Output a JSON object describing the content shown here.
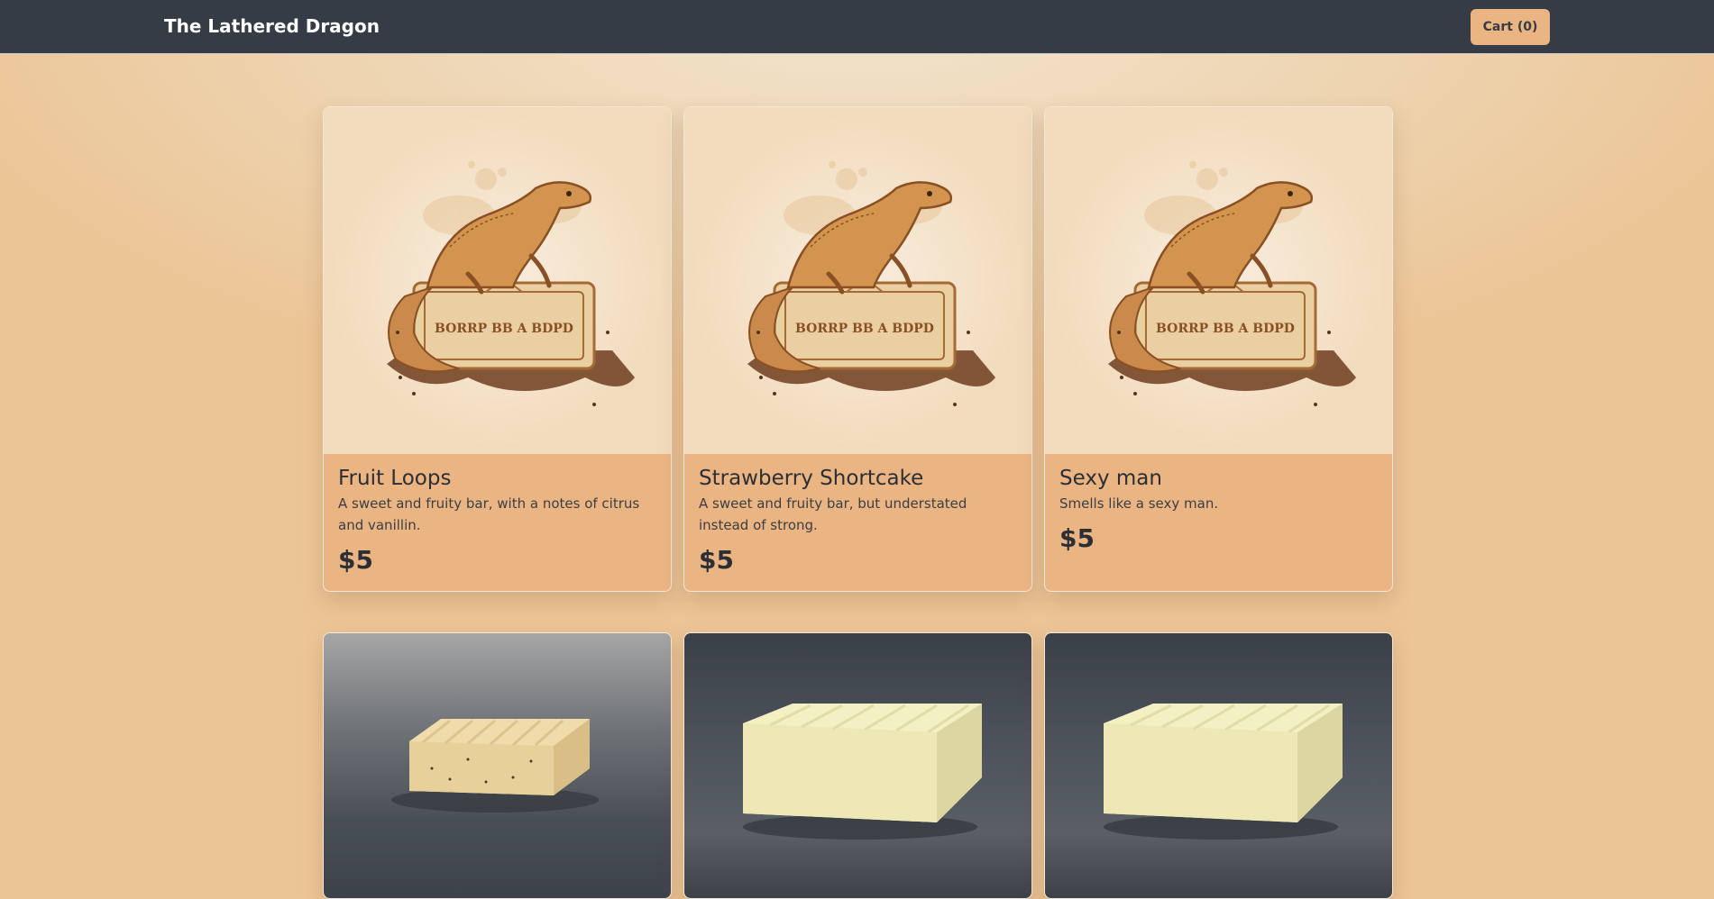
{
  "navbar": {
    "brand": "The Lathered Dragon",
    "cart_label": "Cart (0)"
  },
  "products": [
    {
      "name": "Fruit Loops",
      "description": "A sweet and fruity bar, with a notes of citrus and vanillin.",
      "price": "$5",
      "image": "lizard-on-soap-illustration",
      "label_text": "BORRP BB A BDPD"
    },
    {
      "name": "Strawberry Shortcake",
      "description": "A sweet and fruity bar, but understated instead of strong.",
      "price": "$5",
      "image": "lizard-on-soap-illustration",
      "label_text": "BORRP BB A BDPD"
    },
    {
      "name": "Sexy man",
      "description": "Smells like a sexy man.",
      "price": "$5",
      "image": "lizard-on-soap-illustration",
      "label_text": "BORRP BB A BDPD"
    },
    {
      "image": "speckled-soap-bar-photo"
    },
    {
      "image": "plain-soap-bar-photo"
    },
    {
      "image": "plain-soap-bar-photo"
    }
  ],
  "colors": {
    "navbar": "#363c45",
    "accent": "#ebb583",
    "page_background": "#eed5b2",
    "text_dark": "#2b2f35"
  }
}
